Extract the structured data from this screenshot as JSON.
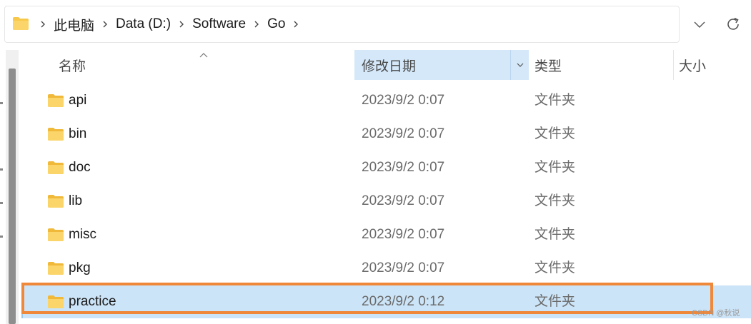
{
  "address_bar": {
    "breadcrumbs": [
      "此电脑",
      "Data (D:)",
      "Software",
      "Go"
    ]
  },
  "columns": {
    "name": "名称",
    "date": "修改日期",
    "type": "类型",
    "size": "大小"
  },
  "files": [
    {
      "name": "api",
      "date": "2023/9/2 0:07",
      "type": "文件夹",
      "selected": false
    },
    {
      "name": "bin",
      "date": "2023/9/2 0:07",
      "type": "文件夹",
      "selected": false
    },
    {
      "name": "doc",
      "date": "2023/9/2 0:07",
      "type": "文件夹",
      "selected": false
    },
    {
      "name": "lib",
      "date": "2023/9/2 0:07",
      "type": "文件夹",
      "selected": false
    },
    {
      "name": "misc",
      "date": "2023/9/2 0:07",
      "type": "文件夹",
      "selected": false
    },
    {
      "name": "pkg",
      "date": "2023/9/2 0:07",
      "type": "文件夹",
      "selected": false
    },
    {
      "name": "practice",
      "date": "2023/9/2 0:12",
      "type": "文件夹",
      "selected": true
    }
  ],
  "icons": {
    "folder": "folder-icon",
    "chevron_right": "chevron-right-icon",
    "chevron_down": "chevron-down-icon",
    "refresh": "refresh-icon",
    "sort_up": "sort-ascending-icon"
  },
  "colors": {
    "folder_yellow": "#f8c84a",
    "selection": "#cce4f7",
    "highlight_outline": "#f0883a"
  },
  "watermark": "CSDN @秋说"
}
